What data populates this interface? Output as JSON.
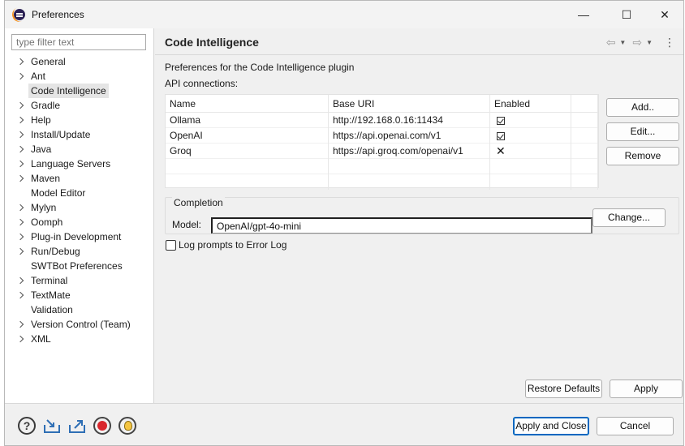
{
  "window": {
    "title": "Preferences",
    "controls": {
      "minimize": "—",
      "maximize": "☐",
      "close": "✕"
    }
  },
  "sidebar": {
    "filter_placeholder": "type filter text",
    "items": [
      {
        "label": "General",
        "expandable": true
      },
      {
        "label": "Ant",
        "expandable": true
      },
      {
        "label": "Code Intelligence",
        "expandable": false,
        "selected": true
      },
      {
        "label": "Gradle",
        "expandable": true
      },
      {
        "label": "Help",
        "expandable": true
      },
      {
        "label": "Install/Update",
        "expandable": true
      },
      {
        "label": "Java",
        "expandable": true
      },
      {
        "label": "Language Servers",
        "expandable": true
      },
      {
        "label": "Maven",
        "expandable": true
      },
      {
        "label": "Model Editor",
        "expandable": false
      },
      {
        "label": "Mylyn",
        "expandable": true
      },
      {
        "label": "Oomph",
        "expandable": true
      },
      {
        "label": "Plug-in Development",
        "expandable": true
      },
      {
        "label": "Run/Debug",
        "expandable": true
      },
      {
        "label": "SWTBot Preferences",
        "expandable": false
      },
      {
        "label": "Terminal",
        "expandable": true
      },
      {
        "label": "TextMate",
        "expandable": true
      },
      {
        "label": "Validation",
        "expandable": false
      },
      {
        "label": "Version Control (Team)",
        "expandable": true
      },
      {
        "label": "XML",
        "expandable": true
      }
    ]
  },
  "page": {
    "title": "Code Intelligence",
    "nav": {
      "back": "⇦",
      "forward": "⇨",
      "menu": "⋮"
    },
    "description": "Preferences for the Code Intelligence plugin",
    "api_label": "API connections:",
    "table": {
      "columns": [
        "Name",
        "Base URI",
        "Enabled"
      ],
      "rows": [
        {
          "name": "Ollama",
          "uri": "http://192.168.0.16:11434",
          "enabled": true
        },
        {
          "name": "OpenAI",
          "uri": "https://api.openai.com/v1",
          "enabled": true
        },
        {
          "name": "Groq",
          "uri": "https://api.groq.com/openai/v1",
          "enabled": false
        }
      ]
    },
    "buttons": {
      "add": "Add..",
      "edit": "Edit...",
      "remove": "Remove"
    },
    "completion": {
      "group_title": "Completion",
      "model_label": "Model:",
      "model_value": "OpenAI/gpt-4o-mini",
      "change_button": "Change..."
    },
    "log_prompts": {
      "label": "Log prompts to Error Log",
      "checked": false
    },
    "restore_defaults": "Restore Defaults",
    "apply": "Apply"
  },
  "footer": {
    "icons": [
      "help-icon",
      "import-icon",
      "export-icon",
      "record-icon",
      "bulb-icon"
    ],
    "apply_close": "Apply and Close",
    "cancel": "Cancel"
  }
}
